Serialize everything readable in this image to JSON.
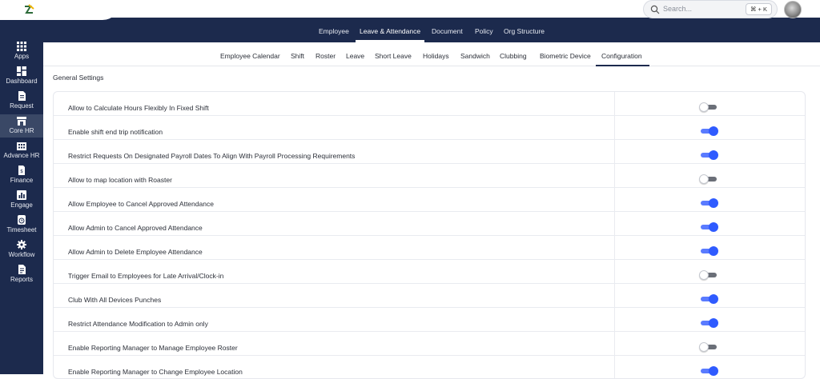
{
  "app": {
    "search_placeholder": "Search...",
    "search_shortcut": "⌘ + K"
  },
  "sidebar": {
    "items": [
      {
        "label": "Apps",
        "icon": "grid-icon"
      },
      {
        "label": "Dashboard",
        "icon": "dashboard-icon"
      },
      {
        "label": "Request",
        "icon": "document-icon"
      },
      {
        "label": "Core HR",
        "icon": "store-icon",
        "active": true
      },
      {
        "label": "Advance HR",
        "icon": "building-icon"
      },
      {
        "label": "Finance",
        "icon": "receipt-icon"
      },
      {
        "label": "Engage",
        "icon": "chart-icon"
      },
      {
        "label": "Timesheet",
        "icon": "clock-icon"
      },
      {
        "label": "Workflow",
        "icon": "gear-icon"
      },
      {
        "label": "Reports",
        "icon": "report-icon"
      }
    ]
  },
  "main_nav": {
    "items": [
      {
        "label": "Employee"
      },
      {
        "label": "Leave & Attendance",
        "active": true
      },
      {
        "label": "Document"
      },
      {
        "label": "Policy"
      },
      {
        "label": "Org Structure"
      }
    ]
  },
  "sub_nav": {
    "items": [
      {
        "label": "Employee Calendar"
      },
      {
        "label": "Shift"
      },
      {
        "label": "Roster"
      },
      {
        "label": "Leave"
      },
      {
        "label": "Short Leave"
      },
      {
        "label": "Holidays"
      },
      {
        "label": "Sandwich"
      },
      {
        "label": "Clubbing"
      },
      {
        "label": "Biometric Device"
      },
      {
        "label": "Configuration",
        "active": true
      }
    ]
  },
  "section": {
    "title": "General Settings"
  },
  "settings": [
    {
      "label": "Allow to Calculate Hours Flexibly In Fixed Shift",
      "enabled": false
    },
    {
      "label": "Enable shift end trip notification",
      "enabled": true
    },
    {
      "label": "Restrict Requests On Designated Payroll Dates To Align With Payroll Processing Requirements",
      "enabled": true
    },
    {
      "label": "Allow to map location with Roaster",
      "enabled": false
    },
    {
      "label": "Allow Employee to Cancel Approved Attendance",
      "enabled": true
    },
    {
      "label": "Allow Admin to Cancel Approved Attendance",
      "enabled": true
    },
    {
      "label": "Allow Admin to Delete Employee Attendance",
      "enabled": true
    },
    {
      "label": "Trigger Email to Employees for Late Arrival/Clock-in",
      "enabled": false
    },
    {
      "label": "Club With All Devices Punches",
      "enabled": true
    },
    {
      "label": "Restrict Attendance Modification to Admin only",
      "enabled": true
    },
    {
      "label": "Enable Reporting Manager to Manage Employee Roster",
      "enabled": false
    },
    {
      "label": "Enable Reporting Manager to Change Employee Location",
      "enabled": true
    }
  ],
  "colors": {
    "navy": "#1c2a4d",
    "toggle_on": "#2f5bff",
    "toggle_off_track": "#6b6f78"
  }
}
